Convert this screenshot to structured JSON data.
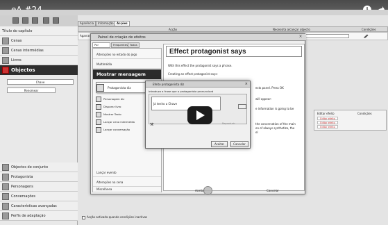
{
  "video": {
    "title": "eA #24",
    "icons": [
      "clock-icon",
      "share-icon"
    ]
  },
  "sidebar": {
    "header_text": "Título do capítulo",
    "items_top": [
      {
        "label": "Cenas",
        "icon": "scene-icon"
      },
      {
        "label": "Cenas intermédias",
        "icon": "cutscene-icon"
      },
      {
        "label": "Livros",
        "icon": "book-icon"
      }
    ],
    "objects_section": {
      "title": "Objectos",
      "field_value": "Chave",
      "field_secondary": "Renomear"
    },
    "items_bottom": [
      {
        "label": "Objectos de conjunto",
        "icon": "set-object-icon"
      },
      {
        "label": "Protagonista",
        "icon": "protagonist-icon"
      },
      {
        "label": "Personagens",
        "icon": "characters-icon"
      },
      {
        "label": "Conversações",
        "icon": "conversations-icon"
      },
      {
        "label": "Características avançadas",
        "icon": "advanced-icon"
      },
      {
        "label": "Perfis de adaptação",
        "icon": "adaptation-icon"
      }
    ]
  },
  "main": {
    "tabs": [
      {
        "label": "Aparência"
      },
      {
        "label": "Informação"
      },
      {
        "label": "Acções"
      }
    ],
    "grid_headers": {
      "action": "Acção",
      "requirement": "Necessita alcançar objecto",
      "conditions": "Condições"
    },
    "row_label": "Agarrar",
    "effects_table": {
      "col1": "Editar efeito",
      "col2": "Condições",
      "rows": [
        "Editar efeito",
        "Editar efeito",
        "Editar efeito"
      ]
    },
    "bottom_checkbox": "Acção activada quando condições inactivas"
  },
  "effects_dialog": {
    "title": "Painel de criação de efeitos",
    "tabs": [
      "Por categorias",
      "Frequentes",
      "Todos"
    ],
    "categories": [
      "Alterações no estado do jogo",
      "Multimédia",
      "Mostrar mensagem",
      "Lançar evento",
      "Alterações na cena",
      "Miscelânea"
    ],
    "effects": [
      "Protagonista diz",
      "Personagem diz",
      "Disparar livro",
      "Mostrar Texto",
      "Lançar cena intermédia",
      "Lançar conversação"
    ],
    "description": {
      "title": "Effect protagonist says",
      "p1": "With this effect the protagonist says a phrase.",
      "p2": "Creating an effect protagonist says:",
      "p3_end": "ects panel. Press OK",
      "p4_end": "will appear:",
      "p5_end": "e information is going to be",
      "p6_end": "the conversation of the main",
      "p7_end": "on of always synthetize, the",
      "p8_end": "el"
    },
    "buttons": {
      "ok": "Aceitar",
      "cancel": "Cancelar"
    }
  },
  "inner_dialog": {
    "title": "Efeito protagonista diz",
    "prompt": "Introduza a frase que o protagonista pronunciará",
    "text_value": "Já tenho a Chave",
    "secondary_field": "Reproduzir",
    "buttons": {
      "ok": "Aceitar",
      "cancel": "Cancelar"
    }
  },
  "colors": {
    "section_header": "#2e2e2e",
    "play_button": "#1c1c1c"
  }
}
